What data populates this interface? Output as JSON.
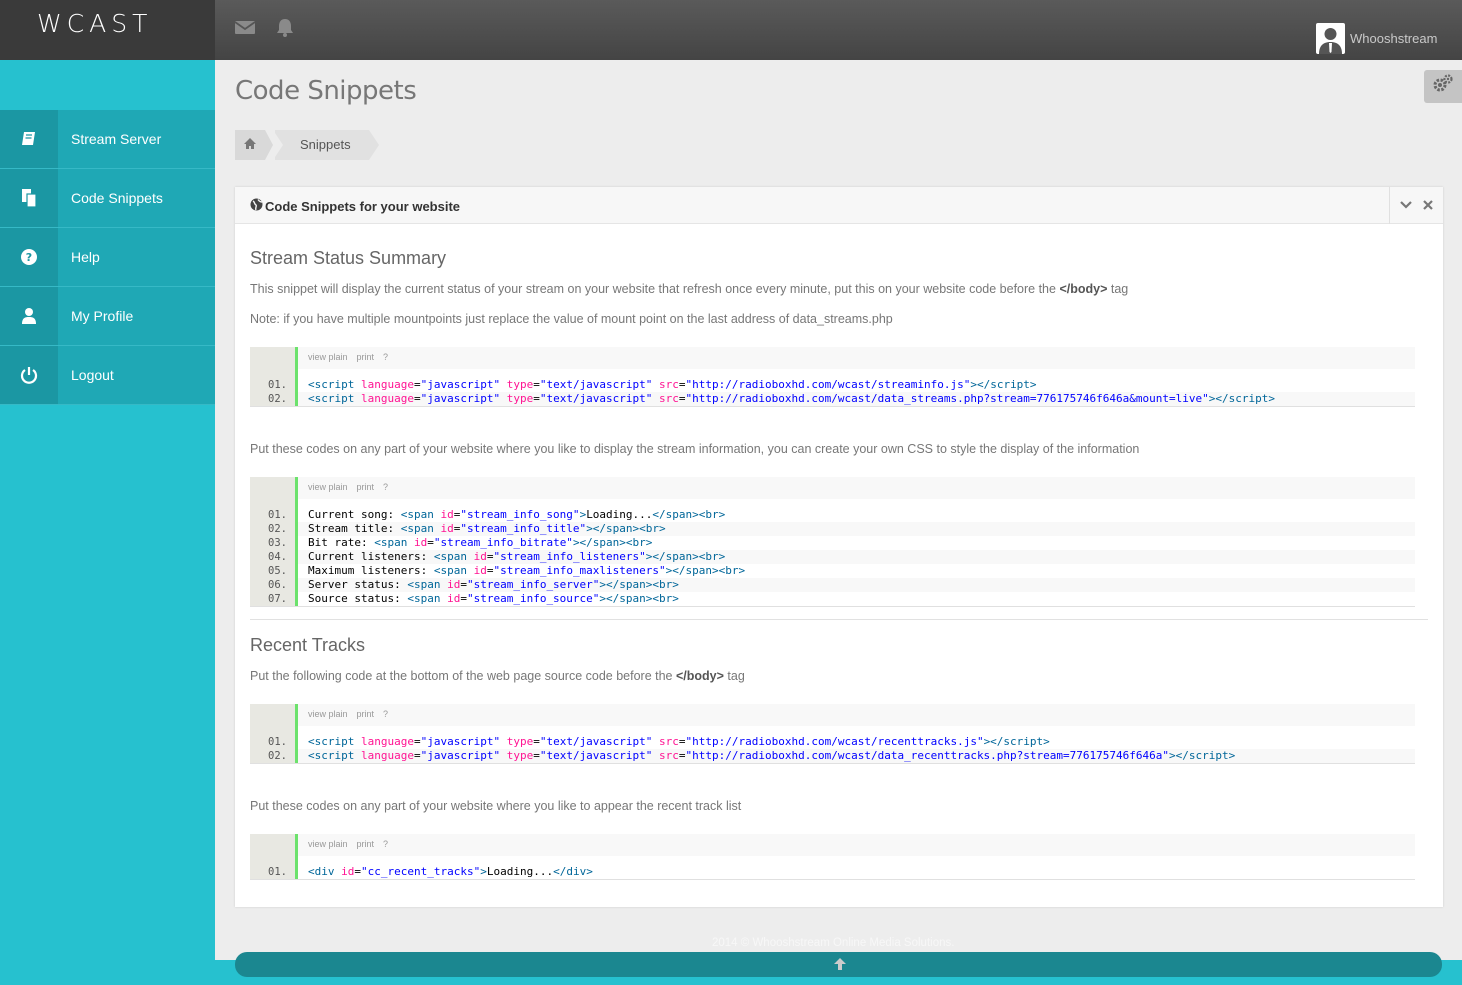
{
  "brand": {
    "name": "WCAST"
  },
  "topbar": {
    "username": "Whooshstream"
  },
  "sidebar": {
    "items": [
      {
        "label": "Stream Server",
        "icon": "book-icon"
      },
      {
        "label": "Code Snippets",
        "icon": "copy-icon"
      },
      {
        "label": "Help",
        "icon": "question-icon"
      },
      {
        "label": "My Profile",
        "icon": "user-icon"
      },
      {
        "label": "Logout",
        "icon": "power-icon"
      }
    ]
  },
  "page": {
    "title": "Code Snippets"
  },
  "breadcrumb": {
    "current": "Snippets"
  },
  "panel": {
    "title": "Code Snippets for your website"
  },
  "toolbar": {
    "view_plain": "view plain",
    "print": "print",
    "help": "?"
  },
  "sections": {
    "status": {
      "heading": "Stream Status Summary",
      "desc1_pre": "This snippet will display the current status of your stream on your website that refresh once every minute, put this on your website code before the ",
      "desc1_bold": "</body>",
      "desc1_post": " tag",
      "desc2": "Note: if you have multiple mountpoints just replace the value of mount point on the last address of data_streams.php",
      "desc3": "Put these codes on any part of your website where you like to display the stream information, you can create your own CSS to style the display of the information"
    },
    "recent": {
      "heading": "Recent Tracks",
      "desc1_pre": "Put the following code at the bottom of the web page source code before the ",
      "desc1_bold": "</body>",
      "desc1_post": " tag",
      "desc2": "Put these codes on any part of your website where you like to appear the recent track list"
    }
  },
  "code_blocks": {
    "status_scripts": {
      "nums": [
        "01.",
        "02."
      ],
      "src1": "\"http://radioboxhd.com/wcast/streaminfo.js\"",
      "src2": "\"http://radioboxhd.com/wcast/data_streams.php?stream=776175746f646a&mount=live\""
    },
    "status_spans": {
      "nums": [
        "01.",
        "02.",
        "03.",
        "04.",
        "05.",
        "06.",
        "07."
      ],
      "labels": [
        "Current song: ",
        "Stream title: ",
        "Bit rate: ",
        "Current listeners: ",
        "Maximum listeners: ",
        "Server status: ",
        "Source status: "
      ],
      "ids": [
        "\"stream_info_song\"",
        "\"stream_info_title\"",
        "\"stream_info_bitrate\"",
        "\"stream_info_listeners\"",
        "\"stream_info_maxlisteners\"",
        "\"stream_info_server\"",
        "\"stream_info_source\""
      ],
      "loading": "Loading..."
    },
    "recent_scripts": {
      "nums": [
        "01.",
        "02."
      ],
      "src1": "\"http://radioboxhd.com/wcast/recenttracks.js\"",
      "src2": "\"http://radioboxhd.com/wcast/data_recenttracks.php?stream=776175746f646a\""
    },
    "recent_div": {
      "nums": [
        "01."
      ],
      "id": "\"cc_recent_tracks\"",
      "loading": "Loading..."
    }
  },
  "footer": {
    "text": "2014 © Whooshstream Online Media Solutions."
  },
  "colors": {
    "sidebar_bg": "#26c1cf",
    "nav_bg": "#1fa8b5",
    "topbar": "#4a4a4a",
    "code_green": "#6ce26c"
  }
}
